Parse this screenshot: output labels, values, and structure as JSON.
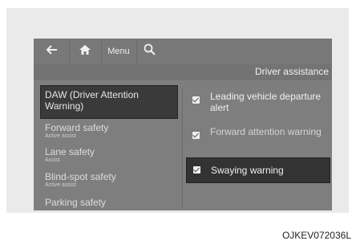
{
  "topbar": {
    "back_icon": "arrow-left-icon",
    "home_icon": "home-icon",
    "menu_label": "Menu",
    "search_icon": "search-icon"
  },
  "page": {
    "title": "Driver assistance"
  },
  "left_menu": {
    "selected": "DAW (Driver Attention Warning)",
    "items": [
      {
        "label": "Forward safety",
        "sub": "Active assist"
      },
      {
        "label": "Lane safety",
        "sub": "Assist"
      },
      {
        "label": "Blind-spot safety",
        "sub": "Active assist"
      },
      {
        "label": "Parking safety",
        "sub": ""
      }
    ]
  },
  "options": [
    {
      "label": "Leading vehicle departure alert",
      "checked": true
    },
    {
      "label": "Forward attention warning",
      "checked": true
    },
    {
      "label": "Swaying warning",
      "checked": true
    }
  ],
  "caption": "OJKEV072036L"
}
